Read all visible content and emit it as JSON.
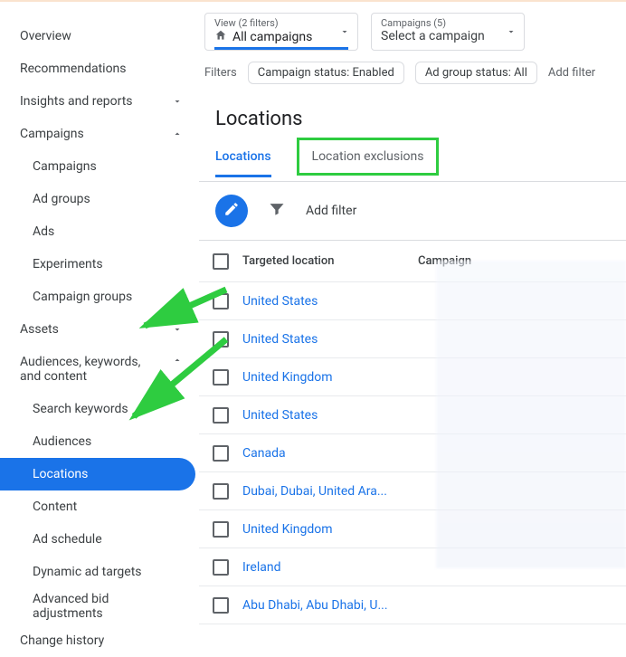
{
  "sidebar": {
    "overview": "Overview",
    "recommendations": "Recommendations",
    "insights": "Insights and reports",
    "campaigns": "Campaigns",
    "campaigns_sub": [
      "Campaigns",
      "Ad groups",
      "Ads",
      "Experiments",
      "Campaign groups"
    ],
    "assets": "Assets",
    "akc": "Audiences, keywords, and content",
    "akc_sub": [
      "Search keywords",
      "Audiences",
      "Locations",
      "Content",
      "Ad schedule",
      "Dynamic ad targets",
      "Advanced bid adjustments"
    ],
    "change_history": "Change history"
  },
  "topbar": {
    "view_hint": "View (2 filters)",
    "view_value": "All campaigns",
    "camp_hint": "Campaigns (5)",
    "camp_value": "Select a campaign"
  },
  "filters_row": {
    "label": "Filters",
    "chip1": "Campaign status: Enabled",
    "chip2": "Ad group status: All",
    "add": "Add filter"
  },
  "section": {
    "title": "Locations",
    "tab_locations": "Locations",
    "tab_exclusions": "Location exclusions",
    "add_filter": "Add filter"
  },
  "table": {
    "col_location": "Targeted location",
    "col_campaign": "Campaign",
    "rows": [
      {
        "loc": "United States"
      },
      {
        "loc": "United States"
      },
      {
        "loc": "United Kingdom"
      },
      {
        "loc": "United States"
      },
      {
        "loc": "Canada"
      },
      {
        "loc": "Dubai, Dubai, United Ara..."
      },
      {
        "loc": "United Kingdom"
      },
      {
        "loc": "Ireland"
      },
      {
        "loc": "Abu Dhabi, Abu Dhabi, U..."
      }
    ]
  }
}
